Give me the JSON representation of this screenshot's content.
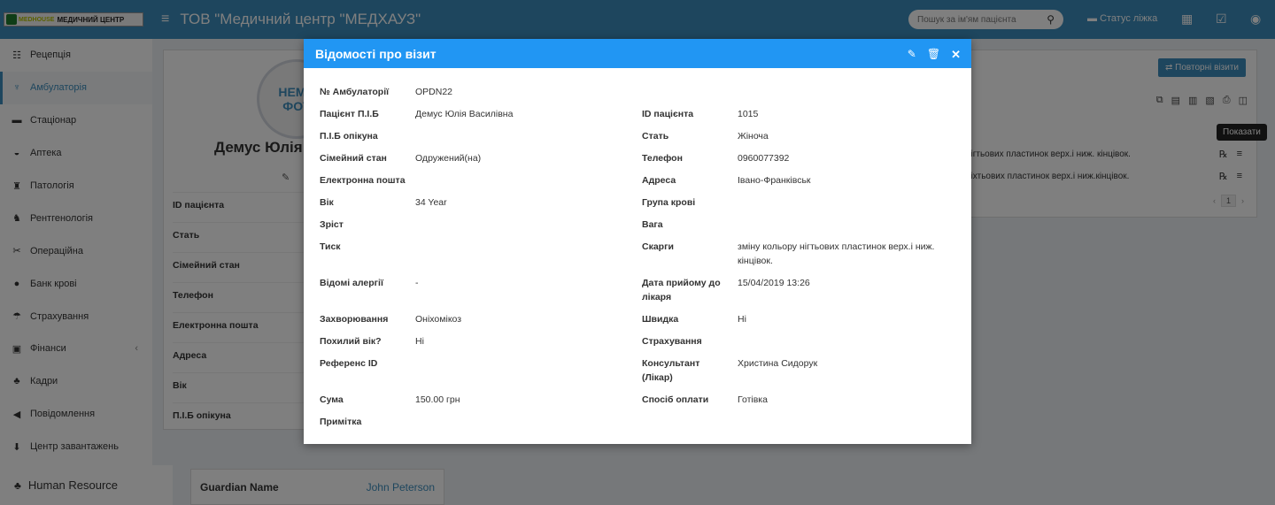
{
  "header": {
    "logo_brand": "MEDHOUSE",
    "logo_text": "МЕДИЧНИЙ ЦЕНТР",
    "title": "ТОВ \"Медичний центр \"МЕДХАУЗ\"",
    "search_placeholder": "Пошук за ім'ям пацієнта",
    "bed_status": "Статус ліжка"
  },
  "sidebar": {
    "items": [
      {
        "label": "Рецепція",
        "icon": "reception-icon",
        "glyph": "☷"
      },
      {
        "label": "Амбулаторія",
        "icon": "stethoscope-icon",
        "glyph": "♆"
      },
      {
        "label": "Стаціонар",
        "icon": "bed-icon",
        "glyph": "▬"
      },
      {
        "label": "Аптека",
        "icon": "mortar-icon",
        "glyph": "◒"
      },
      {
        "label": "Патологія",
        "icon": "microscope-icon",
        "glyph": "♜"
      },
      {
        "label": "Рентгенологія",
        "icon": "xray-icon",
        "glyph": "♞"
      },
      {
        "label": "Операційна",
        "icon": "scissors-icon",
        "glyph": "✂"
      },
      {
        "label": "Банк крові",
        "icon": "blood-drop-icon",
        "glyph": "●"
      },
      {
        "label": "Страхування",
        "icon": "umbrella-icon",
        "glyph": "☂"
      },
      {
        "label": "Фінанси",
        "icon": "money-icon",
        "glyph": "▣"
      },
      {
        "label": "Кадри",
        "icon": "sitemap-icon",
        "glyph": "♣"
      },
      {
        "label": "Повідомлення",
        "icon": "bullhorn-icon",
        "glyph": "◀"
      },
      {
        "label": "Центр завантажень",
        "icon": "download-icon",
        "glyph": "⬇"
      }
    ],
    "human_resource": "Human Resource"
  },
  "profile": {
    "avatar_text_1": "НЕМА",
    "avatar_text_2": "ФОТ",
    "name": "Демус Юлія",
    "rows": [
      "ID пацієнта",
      "Стать",
      "Сімейний стан",
      "Телефон",
      "Електронна пошта",
      "Адреса",
      "Вік",
      "П.І.Б опікуна"
    ],
    "guardian_label": "Guardian Name",
    "guardian_value": "John Peterson"
  },
  "visits": {
    "repeat_button": "Повторні візити",
    "row1": "нігтьових пластинок верх.і ниж. кінцівок.",
    "row2": "ніхтьових пластинок верх.і ниж.кінцівок.",
    "page": "1",
    "tooltip": "Показати"
  },
  "modal": {
    "title": "Відомості про візит",
    "left": [
      {
        "label": "№ Амбулаторії",
        "value": "OPDN22"
      },
      {
        "label": "Пацієнт П.І.Б",
        "value": "Демус Юлія Василівна"
      },
      {
        "label": "П.І.Б опікуна",
        "value": ""
      },
      {
        "label": "Сімейний стан",
        "value": "Одружений(на)"
      },
      {
        "label": "Електронна пошта",
        "value": ""
      },
      {
        "label": "Вік",
        "value": "34 Year"
      },
      {
        "label": "Зріст",
        "value": ""
      },
      {
        "label": "Тиск",
        "value": ""
      },
      {
        "label": "Відомі алергії",
        "value": "-"
      },
      {
        "label": "Захворювання",
        "value": "Оніхомікоз"
      },
      {
        "label": "Похилий вік?",
        "value": "Ні"
      },
      {
        "label": "Референс ID",
        "value": ""
      },
      {
        "label": "Сума",
        "value": "150.00 грн"
      },
      {
        "label": "Примітка",
        "value": ""
      }
    ],
    "right": [
      {
        "label": "ID пацієнта",
        "value": "1015"
      },
      {
        "label": "Стать",
        "value": "Жіноча"
      },
      {
        "label": "Телефон",
        "value": "0960077392"
      },
      {
        "label": "Адреса",
        "value": "Івано-Франківськ"
      },
      {
        "label": "Група крові",
        "value": ""
      },
      {
        "label": "Вага",
        "value": ""
      },
      {
        "label": "Скарги",
        "value": "зміну кольору нігтьових пластинок верх.і ниж. кінцівок."
      },
      {
        "label": "Дата прийому до лікаря",
        "value": "15/04/2019 13:26"
      },
      {
        "label": "Швидка",
        "value": "Ні"
      },
      {
        "label": "Страхування",
        "value": ""
      },
      {
        "label": "Консультант (Лікар)",
        "value": "Христина Сидорук"
      },
      {
        "label": "Спосіб оплати",
        "value": "Готівка"
      }
    ]
  }
}
